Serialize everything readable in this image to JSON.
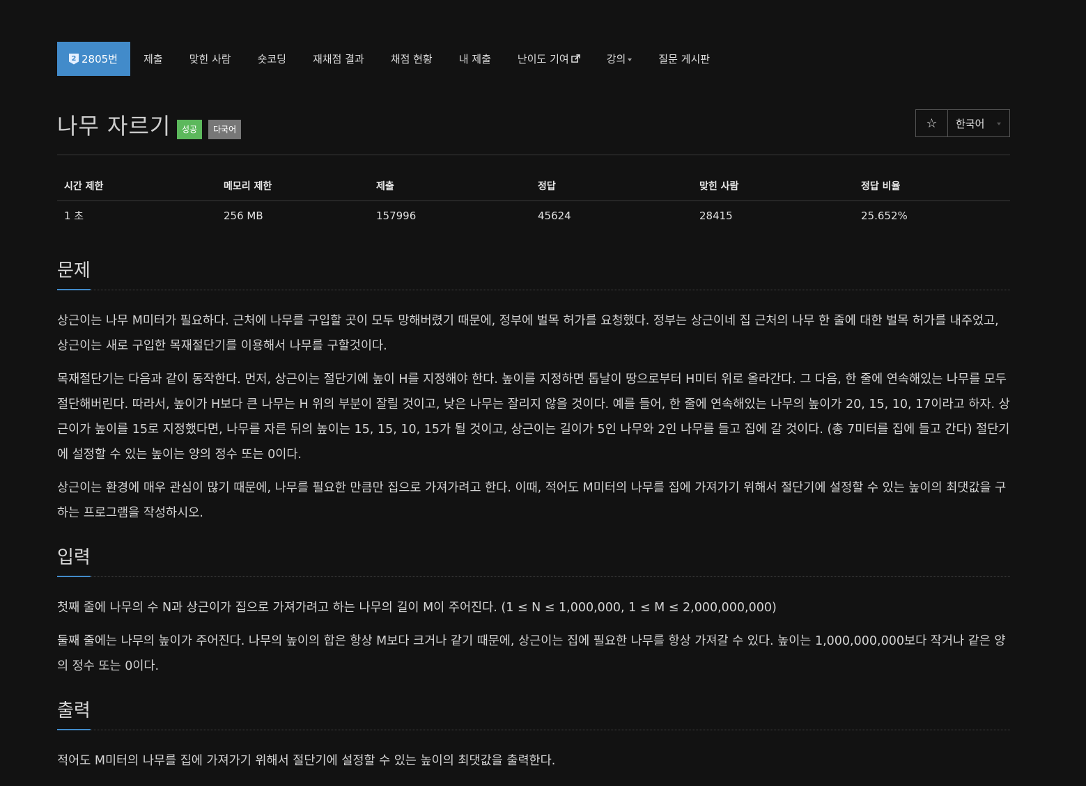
{
  "nav": {
    "problem_number": "2805번",
    "tier_glyph": "2",
    "items": [
      "제출",
      "맞힌 사람",
      "숏코딩",
      "재채점 결과",
      "채점 현황",
      "내 제출",
      "난이도 기여",
      "강의",
      "질문 게시판"
    ]
  },
  "problem": {
    "title": "나무 자르기",
    "labels": {
      "success": "성공",
      "multilang": "다국어"
    },
    "star": "☆",
    "language": "한국어"
  },
  "stats": {
    "headers": [
      "시간 제한",
      "메모리 제한",
      "제출",
      "정답",
      "맞힌 사람",
      "정답 비율"
    ],
    "values": [
      "1 초",
      "256 MB",
      "157996",
      "45624",
      "28415",
      "25.652%"
    ]
  },
  "sections": {
    "description": {
      "heading": "문제",
      "paragraphs": [
        "상근이는 나무 M미터가 필요하다. 근처에 나무를 구입할 곳이 모두 망해버렸기 때문에, 정부에 벌목 허가를 요청했다. 정부는 상근이네 집 근처의 나무 한 줄에 대한 벌목 허가를 내주었고, 상근이는 새로 구입한 목재절단기를 이용해서 나무를 구할것이다.",
        "목재절단기는 다음과 같이 동작한다. 먼저, 상근이는 절단기에 높이 H를 지정해야 한다. 높이를 지정하면 톱날이 땅으로부터 H미터 위로 올라간다. 그 다음, 한 줄에 연속해있는 나무를 모두 절단해버린다. 따라서, 높이가 H보다 큰 나무는 H 위의 부분이 잘릴 것이고, 낮은 나무는 잘리지 않을 것이다. 예를 들어, 한 줄에 연속해있는 나무의 높이가 20, 15, 10, 17이라고 하자. 상근이가 높이를 15로 지정했다면, 나무를 자른 뒤의 높이는 15, 15, 10, 15가 될 것이고, 상근이는 길이가 5인 나무와 2인 나무를 들고 집에 갈 것이다. (총 7미터를 집에 들고 간다) 절단기에 설정할 수 있는 높이는 양의 정수 또는 0이다.",
        "상근이는 환경에 매우 관심이 많기 때문에, 나무를 필요한 만큼만 집으로 가져가려고 한다. 이때, 적어도 M미터의 나무를 집에 가져가기 위해서 절단기에 설정할 수 있는 높이의 최댓값을 구하는 프로그램을 작성하시오."
      ]
    },
    "input": {
      "heading": "입력",
      "paragraphs": [
        "첫째 줄에 나무의 수 N과 상근이가 집으로 가져가려고 하는 나무의 길이 M이 주어진다. (1 ≤ N ≤ 1,000,000, 1 ≤ M ≤ 2,000,000,000)",
        "둘째 줄에는 나무의 높이가 주어진다. 나무의 높이의 합은 항상 M보다 크거나 같기 때문에, 상근이는 집에 필요한 나무를 항상 가져갈 수 있다. 높이는 1,000,000,000보다 작거나 같은 양의 정수 또는 0이다."
      ]
    },
    "output": {
      "heading": "출력",
      "paragraphs": [
        "적어도 M미터의 나무를 집에 가져가기 위해서 절단기에 설정할 수 있는 높이의 최댓값을 출력한다."
      ]
    }
  }
}
